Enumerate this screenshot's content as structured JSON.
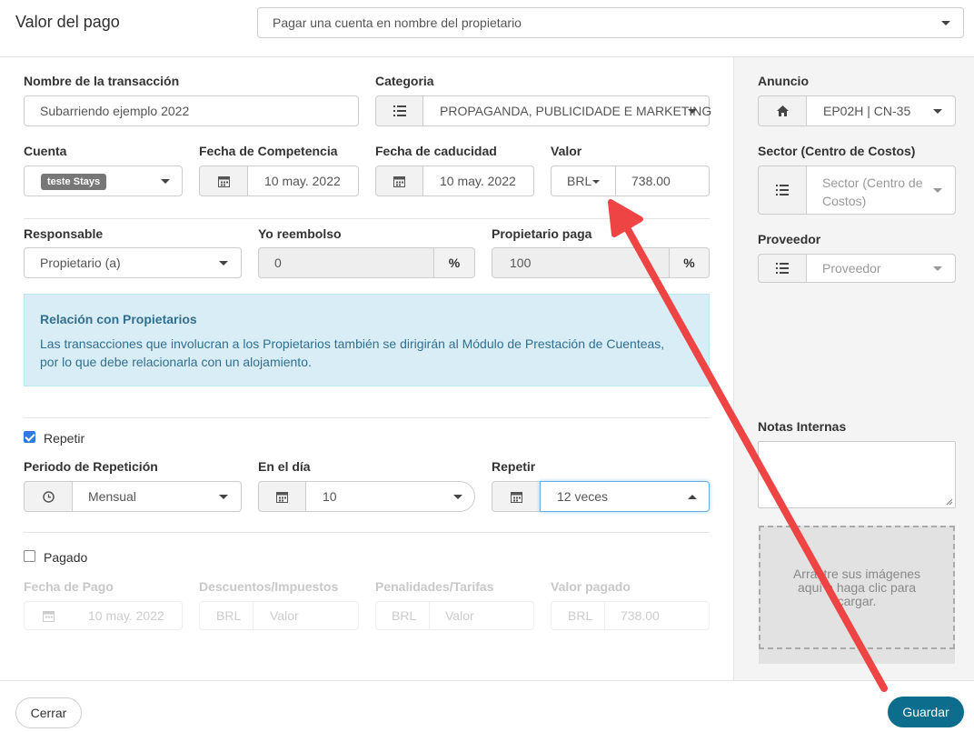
{
  "header": {
    "title": "Valor del pago",
    "payment_type": "Pagar una cuenta en nombre del propietario"
  },
  "transaction": {
    "name_label": "Nombre de la transacción",
    "name_value": "Subarriendo ejemplo 2022",
    "category_label": "Categoria",
    "category_value": "PROPAGANDA, PUBLICIDADE E MARKETING",
    "account_label": "Cuenta",
    "account_value": "teste Stays",
    "competence_label": "Fecha de Competencia",
    "competence_value": "10 may. 2022",
    "due_label": "Fecha de caducidad",
    "due_value": "10 may. 2022",
    "value_label": "Valor",
    "currency": "BRL",
    "amount": "738.00"
  },
  "responsibility": {
    "responsible_label": "Responsable",
    "responsible_value": "Propietario (a)",
    "reimburse_label": "Yo reembolso",
    "reimburse_value": "0",
    "owner_pays_label": "Propietario paga",
    "owner_pays_value": "100",
    "percent_symbol": "%"
  },
  "info": {
    "title": "Relación con Propietarios",
    "text": "Las transacciones que involucran a los Propietarios también se dirigirán al Módulo de Prestación de Cuenteas, por lo que debe relacionarla con un alojamiento."
  },
  "repeat": {
    "checkbox_label": "Repetir",
    "checked": true,
    "period_label": "Periodo de Repetición",
    "period_value": "Mensual",
    "day_label": "En el día",
    "day_value": "10",
    "times_label": "Repetir",
    "times_value": "12 veces"
  },
  "paid": {
    "checkbox_label": "Pagado",
    "checked": false,
    "payment_date_label": "Fecha de Pago",
    "payment_date_value": "10 may. 2022",
    "discounts_label": "Descuentos/Impuestos",
    "discounts_currency": "BRL",
    "discounts_placeholder": "Valor",
    "penalties_label": "Penalidades/Tarifas",
    "penalties_currency": "BRL",
    "penalties_placeholder": "Valor",
    "paid_value_label": "Valor pagado",
    "paid_currency": "BRL",
    "paid_value": "738.00"
  },
  "sidebar": {
    "listing_label": "Anuncio",
    "listing_value": "EP02H | CN-35",
    "sector_label": "Sector (Centro de Costos)",
    "sector_placeholder": "Sector (Centro de Costos)",
    "provider_label": "Proveedor",
    "provider_placeholder": "Proveedor",
    "notes_label": "Notas Internas",
    "dropzone_text": "Arrastre sus imágenes aquí o haga clic para cargar."
  },
  "footer": {
    "close_label": "Cerrar",
    "save_label": "Guardar"
  },
  "colors": {
    "primary": "#0d6d8c",
    "info_bg": "#d9edf7",
    "info_text": "#31708f",
    "annotation_arrow": "#ef4444",
    "checkbox": "#2c7be5"
  },
  "icons": [
    "list-icon",
    "calendar-icon",
    "clock-icon",
    "home-icon",
    "chevron-down-icon",
    "chevron-up-icon"
  ]
}
